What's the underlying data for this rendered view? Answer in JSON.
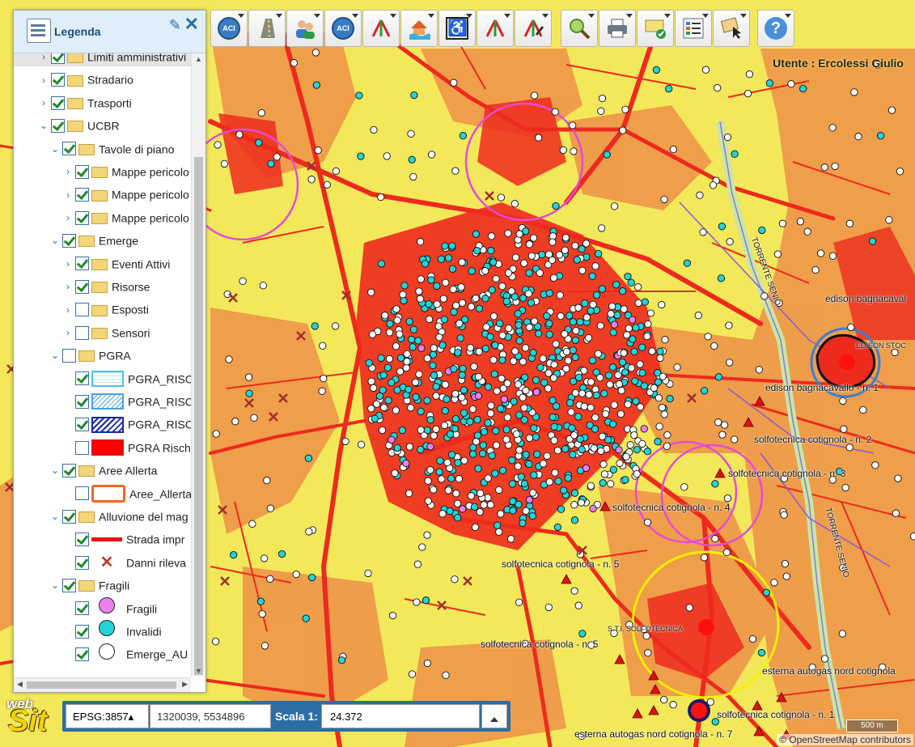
{
  "legend": {
    "title": "Legenda",
    "items": [
      {
        "label": "Limiti amministrativi",
        "level": 1,
        "expand": "›",
        "checked": true,
        "kind": "folder",
        "selected": true
      },
      {
        "label": "Stradario",
        "level": 1,
        "expand": "›",
        "checked": true,
        "kind": "folder"
      },
      {
        "label": "Trasporti",
        "level": 1,
        "expand": "›",
        "checked": true,
        "kind": "folder"
      },
      {
        "label": "UCBR",
        "level": 1,
        "expand": "⌄",
        "checked": true,
        "kind": "folder"
      },
      {
        "label": "Tavole di piano",
        "level": 2,
        "expand": "⌄",
        "checked": true,
        "kind": "folder"
      },
      {
        "label": "Mappe pericolo",
        "level": 3,
        "expand": "›",
        "checked": true,
        "kind": "folder"
      },
      {
        "label": "Mappe pericolo",
        "level": 3,
        "expand": "›",
        "checked": true,
        "kind": "folder"
      },
      {
        "label": "Mappe pericolo",
        "level": 3,
        "expand": "›",
        "checked": true,
        "kind": "folder"
      },
      {
        "label": "Emerge",
        "level": 2,
        "expand": "⌄",
        "checked": true,
        "kind": "folder"
      },
      {
        "label": "Eventi Attivi",
        "level": 3,
        "expand": "›",
        "checked": true,
        "kind": "folder"
      },
      {
        "label": "Risorse",
        "level": 3,
        "expand": "›",
        "checked": true,
        "kind": "folder"
      },
      {
        "label": "Esposti",
        "level": 3,
        "expand": "›",
        "checked": false,
        "kind": "folder"
      },
      {
        "label": "Sensori",
        "level": 3,
        "expand": "›",
        "checked": false,
        "kind": "folder"
      },
      {
        "label": "PGRA",
        "level": 2,
        "expand": "⌄",
        "checked": false,
        "kind": "folder"
      },
      {
        "label": "PGRA_RISC",
        "level": 3,
        "checked": true,
        "kind": "sym-rect-light"
      },
      {
        "label": "PGRA_RISC",
        "level": 3,
        "checked": true,
        "kind": "sym-rect-hatch"
      },
      {
        "label": "PGRA_RISC",
        "level": 3,
        "checked": true,
        "kind": "sym-rect-dark"
      },
      {
        "label": "PGRA Risch",
        "level": 3,
        "checked": false,
        "kind": "sym-rect-red"
      },
      {
        "label": "Aree Allerta",
        "level": 2,
        "expand": "⌄",
        "checked": true,
        "kind": "folder"
      },
      {
        "label": "Aree_Allerta",
        "level": 3,
        "checked": false,
        "kind": "sym-rect-orange"
      },
      {
        "label": "Alluvione del mag",
        "level": 2,
        "expand": "⌄",
        "checked": true,
        "kind": "folder"
      },
      {
        "label": "Strada impr",
        "level": 3,
        "checked": true,
        "kind": "sym-line-red"
      },
      {
        "label": "Danni rileva",
        "level": 3,
        "checked": true,
        "kind": "sym-cross"
      },
      {
        "label": "Fragili",
        "level": 2,
        "expand": "⌄",
        "checked": true,
        "kind": "folder"
      },
      {
        "label": "Fragili",
        "level": 3,
        "checked": true,
        "kind": "sym-dot-pink"
      },
      {
        "label": "Invalidi",
        "level": 3,
        "checked": true,
        "kind": "sym-dot-cyan"
      },
      {
        "label": "Emerge_AU",
        "level": 3,
        "checked": true,
        "kind": "sym-dot-white"
      }
    ]
  },
  "toolbar": {
    "buttons": [
      {
        "name": "aci-button",
        "icon": "aci-icon"
      },
      {
        "name": "road-button",
        "icon": "road-icon"
      },
      {
        "name": "users-button",
        "icon": "users-icon"
      },
      {
        "name": "aci-button-2",
        "icon": "aci-icon"
      },
      {
        "name": "route-button",
        "icon": "route-icon"
      },
      {
        "name": "flood-house-button",
        "icon": "flood-house-icon"
      },
      {
        "name": "accessibility-button",
        "icon": "wheelchair-icon"
      },
      {
        "name": "route-button-2",
        "icon": "route-icon"
      },
      {
        "name": "route-edit-button",
        "icon": "route-edit-icon"
      },
      {
        "name": "search-button",
        "icon": "magnifier-icon"
      },
      {
        "name": "print-button",
        "icon": "printer-icon"
      },
      {
        "name": "message-button",
        "icon": "message-check-icon"
      },
      {
        "name": "legend-list-button",
        "icon": "list-icon"
      },
      {
        "name": "select-button",
        "icon": "cursor-icon"
      },
      {
        "name": "help-button",
        "icon": "help-icon"
      }
    ],
    "aci_text": "ACI",
    "help_text": "?"
  },
  "user": "Utente : Ercolessi Giulio",
  "coordbar": {
    "epsg": "EPSG:3857▴",
    "coords": "1320039, 5534896",
    "scale_label": "Scala 1:",
    "scale_value": "24.372"
  },
  "logo": {
    "web": "web",
    "sit": "Sit"
  },
  "scalebar": "500 m",
  "attribution": "© OpenStreetMap contributors",
  "map_labels": {
    "river": "TORRENTE SENIO",
    "river_2": "TORRENTE SENIO",
    "edison_1": "edison bagnacaval",
    "edison_stoc": "EDISON STOC",
    "edison_2": "edison bagnacavallo - n. 1",
    "solfo_2": "solfotecnica cotignola - n. 2",
    "solfo_3": "solfotecnica cotignola - n. 3",
    "solfo_4": "solfotecnica cotignola - n. 4",
    "solfo_5a": "solfotecnica cotignola - n. 5",
    "sti": "S.T.I. SOLFOTECNICA",
    "solfo_5b": "solfotecnica cotignola - n. 5",
    "esterna_1": "esterna autogas nord cotignola",
    "solfo_1": "solfotecnica cotignola - n. 1",
    "esterna_7": "esterna autogas nord cotignola - n. 7"
  },
  "colors": {
    "base_yellow": "#f3e85a",
    "orange": "#ee9a4a",
    "red": "#ee2a1d",
    "cyan": "#22d3d8",
    "magenta": "#e44bd8",
    "accent": "#2e6da4"
  }
}
